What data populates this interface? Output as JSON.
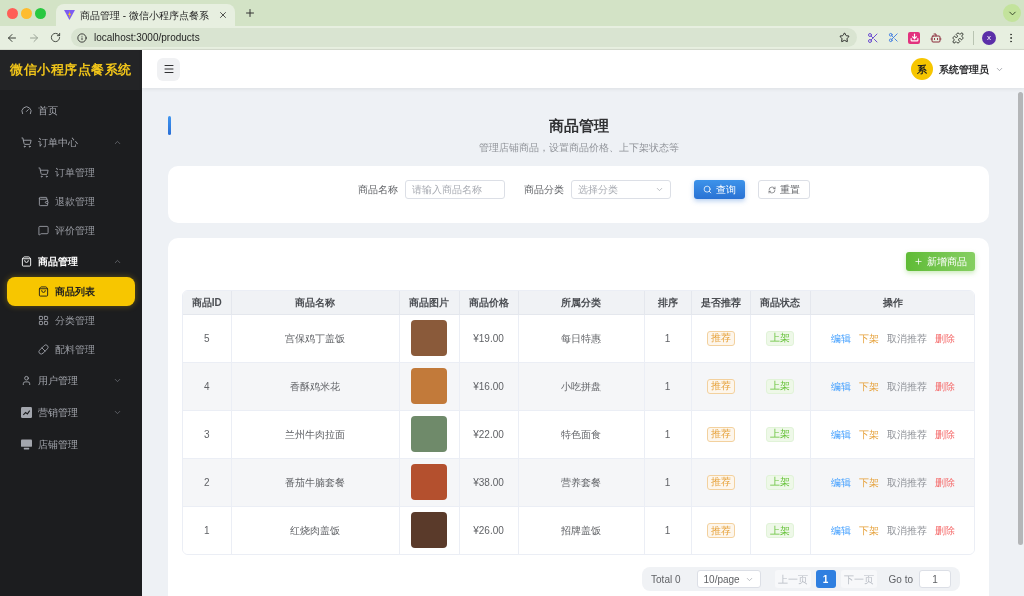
{
  "browser": {
    "tab_title": "商品管理 - 微信小程序点餐系",
    "url": "localhost:3000/products",
    "profile_initial": "x"
  },
  "sidebar": {
    "title": "微信小程序点餐系统",
    "items": [
      {
        "kind": "link",
        "label": "首页",
        "selected": false
      },
      {
        "kind": "group",
        "label": "订单中心",
        "expanded": true,
        "children": [
          {
            "label": "订单管理",
            "selected": false
          },
          {
            "label": "退款管理",
            "selected": false
          },
          {
            "label": "评价管理",
            "selected": false
          }
        ]
      },
      {
        "kind": "group",
        "label": "商品管理",
        "expanded": true,
        "children": [
          {
            "label": "商品列表",
            "selected": true
          },
          {
            "label": "分类管理",
            "selected": false
          },
          {
            "label": "配料管理",
            "selected": false
          }
        ]
      },
      {
        "kind": "group",
        "label": "用户管理",
        "expanded": false
      },
      {
        "kind": "group",
        "label": "营销管理",
        "expanded": false
      },
      {
        "kind": "link",
        "label": "店铺管理",
        "selected": false
      }
    ]
  },
  "header": {
    "avatar_text": "系",
    "user_name": "系统管理员"
  },
  "page": {
    "title": "商品管理",
    "subtitle": "管理店铺商品，设置商品价格、上下架状态等"
  },
  "filters": {
    "fields": [
      {
        "kind": "input",
        "label": "商品名称",
        "placeholder": "请输入商品名称"
      },
      {
        "kind": "select",
        "label": "商品分类",
        "placeholder": "选择分类"
      }
    ],
    "buttons": [
      {
        "kind": "primary",
        "label": "查询"
      },
      {
        "kind": "default",
        "label": "重置"
      }
    ]
  },
  "table": {
    "add_button": "新增商品",
    "columns": [
      "商品ID",
      "商品名称",
      "商品图片",
      "商品价格",
      "所属分类",
      "排序",
      "是否推荐",
      "商品状态",
      "操作"
    ],
    "rows": [
      {
        "id": "5",
        "name": "宫保鸡丁盖饭",
        "price": "¥19.00",
        "category": "每日特惠",
        "sort": "1",
        "recommend": {
          "label": "推荐",
          "kind": "warning"
        },
        "status": {
          "label": "上架",
          "kind": "success"
        },
        "actions": [
          {
            "label": "编辑",
            "kind": "primary"
          },
          {
            "label": "下架",
            "kind": "warning"
          },
          {
            "label": "取消推荐",
            "kind": "info"
          },
          {
            "label": "删除",
            "kind": "danger"
          }
        ]
      },
      {
        "id": "4",
        "name": "香酥鸡米花",
        "price": "¥16.00",
        "category": "小吃拼盘",
        "sort": "1",
        "recommend": {
          "label": "推荐",
          "kind": "warning"
        },
        "status": {
          "label": "上架",
          "kind": "success"
        },
        "actions": [
          {
            "label": "编辑",
            "kind": "primary"
          },
          {
            "label": "下架",
            "kind": "warning"
          },
          {
            "label": "取消推荐",
            "kind": "info"
          },
          {
            "label": "删除",
            "kind": "danger"
          }
        ]
      },
      {
        "id": "3",
        "name": "兰州牛肉拉面",
        "price": "¥22.00",
        "category": "特色面食",
        "sort": "1",
        "recommend": {
          "label": "推荐",
          "kind": "warning"
        },
        "status": {
          "label": "上架",
          "kind": "success"
        },
        "actions": [
          {
            "label": "编辑",
            "kind": "primary"
          },
          {
            "label": "下架",
            "kind": "warning"
          },
          {
            "label": "取消推荐",
            "kind": "info"
          },
          {
            "label": "删除",
            "kind": "danger"
          }
        ]
      },
      {
        "id": "2",
        "name": "番茄牛腩套餐",
        "price": "¥38.00",
        "category": "营养套餐",
        "sort": "1",
        "recommend": {
          "label": "推荐",
          "kind": "warning"
        },
        "status": {
          "label": "上架",
          "kind": "success"
        },
        "actions": [
          {
            "label": "编辑",
            "kind": "primary"
          },
          {
            "label": "下架",
            "kind": "warning"
          },
          {
            "label": "取消推荐",
            "kind": "info"
          },
          {
            "label": "删除",
            "kind": "danger"
          }
        ]
      },
      {
        "id": "1",
        "name": "红烧肉盖饭",
        "price": "¥26.00",
        "category": "招牌盖饭",
        "sort": "1",
        "recommend": {
          "label": "推荐",
          "kind": "warning"
        },
        "status": {
          "label": "上架",
          "kind": "success"
        },
        "actions": [
          {
            "label": "编辑",
            "kind": "primary"
          },
          {
            "label": "下架",
            "kind": "warning"
          },
          {
            "label": "取消推荐",
            "kind": "info"
          },
          {
            "label": "删除",
            "kind": "danger"
          }
        ]
      }
    ]
  },
  "pagination": {
    "total": "Total 0",
    "page_size": "10/page",
    "prev": {
      "label": "上一页",
      "disabled": true
    },
    "pages": [
      {
        "label": "1",
        "selected": true
      }
    ],
    "next": {
      "label": "下一页",
      "disabled": true
    },
    "goto_label": "Go to",
    "goto_value": "1"
  }
}
